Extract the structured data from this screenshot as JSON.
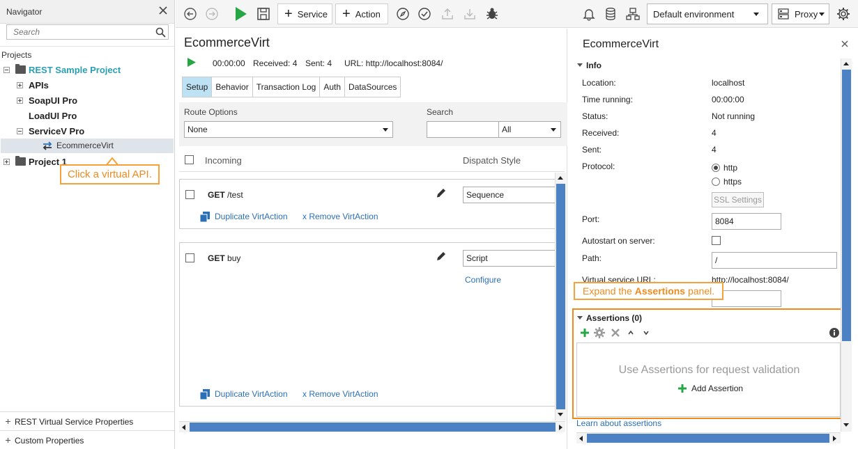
{
  "navigator": {
    "title": "Navigator",
    "search_placeholder": "Search",
    "projects_label": "Projects",
    "tree": {
      "rest_project": "REST Sample Project",
      "apis": "APIs",
      "soapui": "SoapUI Pro",
      "loadui": "LoadUI Pro",
      "servicev": "ServiceV Pro",
      "ecommerce": "EcommerceVirt",
      "project1": "Project 1"
    },
    "bottom": {
      "rest_props": "REST Virtual Service Properties",
      "custom_props": "Custom Properties"
    }
  },
  "callouts": {
    "virtual_api": "Click a virtual API.",
    "expand_pre": "Expand the ",
    "expand_bold": "Assertions",
    "expand_post": " panel."
  },
  "toolbar": {
    "service_label": "Service",
    "action_label": "Action",
    "environment": "Default environment",
    "proxy": "Proxy"
  },
  "service": {
    "title": "EcommerceVirt",
    "time": "00:00:00",
    "received": "Received: 4",
    "sent": "Sent: 4",
    "url": "URL: http://localhost:8084/",
    "tabs": [
      "Setup",
      "Behavior",
      "Transaction Log",
      "Auth",
      "DataSources"
    ],
    "route_options_label": "Route Options",
    "route_options_value": "None",
    "search_label": "Search",
    "search_scope": "All",
    "incoming_header": "Incoming",
    "dispatch_header": "Dispatch Style",
    "actions": [
      {
        "method": "GET",
        "path": "/test",
        "dispatch": "Sequence"
      },
      {
        "method": "GET",
        "path": "buy",
        "dispatch": "Script",
        "configure": "Configure"
      }
    ],
    "duplicate_label": "Duplicate VirtAction",
    "remove_label": "x Remove VirtAction"
  },
  "properties": {
    "title": "EcommerceVirt",
    "info_label": "Info",
    "location_label": "Location:",
    "location": "localhost",
    "time_running_label": "Time running:",
    "time_running": "00:00:00",
    "status_label": "Status:",
    "status": "Not running",
    "received_label": "Received:",
    "received": "4",
    "sent_label": "Sent:",
    "sent": "4",
    "protocol_label": "Protocol:",
    "protocol_http": "http",
    "protocol_https": "https",
    "ssl_settings": "SSL Settings",
    "port_label": "Port:",
    "port": "8084",
    "autostart_label": "Autostart on server:",
    "path_label": "Path:",
    "path": "/",
    "vs_url_label": "Virtual service URL:",
    "vs_url": "http://localhost:8084/",
    "assertions_label": "Assertions (0)",
    "assert_empty_msg": "Use Assertions for request validation",
    "add_assertion": "Add Assertion",
    "learn_link": "Learn about assertions"
  },
  "colors": {
    "accent_orange": "#f08a1c",
    "teal_project": "#2a9fb4",
    "tab_active": "#bde2f4",
    "link_blue": "#2b6fb6",
    "scroll_thumb": "#4c81c4",
    "play_green": "#27a644"
  }
}
